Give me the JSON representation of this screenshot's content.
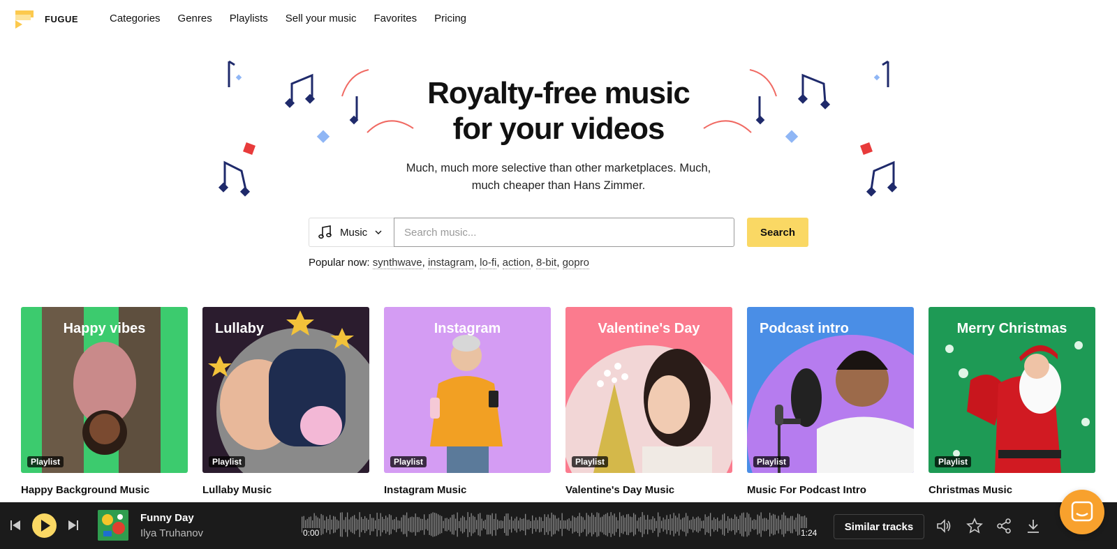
{
  "brand": {
    "name": "FUGUE"
  },
  "nav": {
    "items": [
      "Categories",
      "Genres",
      "Playlists",
      "Sell your music",
      "Favorites",
      "Pricing"
    ]
  },
  "hero": {
    "title_line1": "Royalty-free music",
    "title_line2": "for your videos",
    "subtitle_line1": "Much, much more selective than other marketplaces. Much,",
    "subtitle_line2": "much cheaper than Hans Zimmer."
  },
  "search": {
    "type_label": "Music",
    "placeholder": "Search music...",
    "button_label": "Search"
  },
  "popular": {
    "label": "Popular now:",
    "tags": [
      "synthwave",
      "instagram",
      "lo-fi",
      "action",
      "8-bit",
      "gopro"
    ]
  },
  "cards": [
    {
      "overlay": "Happy vibes",
      "badge": "Playlist",
      "name": "Happy Background Music",
      "bg": "#3ccb6e"
    },
    {
      "overlay": "Lullaby",
      "badge": "Playlist",
      "name": "Lullaby Music",
      "bg": "#2b1c2e"
    },
    {
      "overlay": "Instagram",
      "badge": "Playlist",
      "name": "Instagram Music",
      "bg": "#d49cf3"
    },
    {
      "overlay": "Valentine's Day",
      "badge": "Playlist",
      "name": "Valentine's Day Music",
      "bg": "#fb7b8e"
    },
    {
      "overlay": "Podcast intro",
      "badge": "Playlist",
      "name": "Music For Podcast Intro",
      "bg": "#4a8ee6"
    },
    {
      "overlay": "Merry Christmas",
      "badge": "Playlist",
      "name": "Christmas Music",
      "bg": "#1e9a55"
    }
  ],
  "player": {
    "title": "Funny Day",
    "artist": "Ilya Truhanov",
    "time_start": "0:00",
    "time_end": "1:24",
    "similar_label": "Similar tracks",
    "accent": "#fad864"
  },
  "icons": [
    "logo-flag-icon",
    "music-note-icon",
    "chevron-down-icon",
    "previous-icon",
    "play-icon",
    "next-icon",
    "volume-icon",
    "star-icon",
    "share-icon",
    "download-icon",
    "chat-icon"
  ]
}
